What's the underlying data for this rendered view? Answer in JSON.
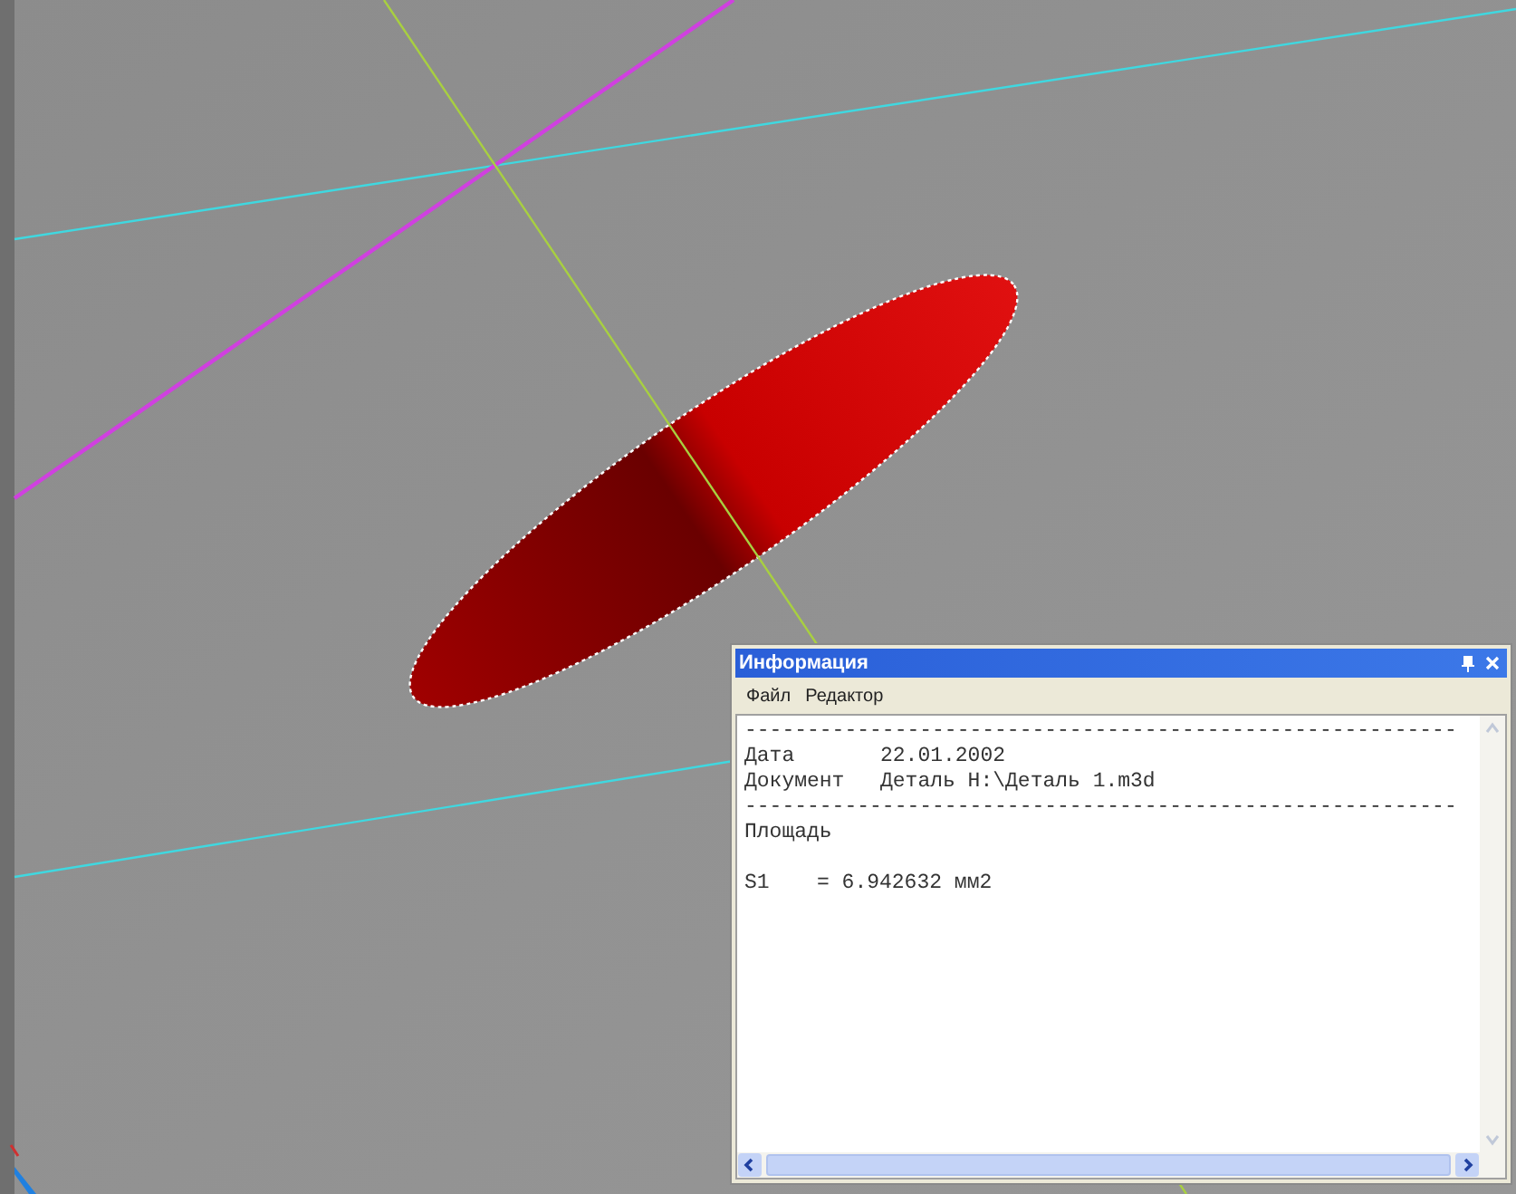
{
  "panel": {
    "title": "Информация",
    "menu": [
      {
        "label": "Файл"
      },
      {
        "label": "Редактор"
      }
    ],
    "lines": [
      {
        "kind": "rule",
        "text": "---------------------------------------------------------"
      },
      {
        "kind": "field",
        "label": "Дата",
        "value": "22.01.2002"
      },
      {
        "kind": "field",
        "label": "Документ",
        "value": "Деталь H:\\Деталь 1.m3d"
      },
      {
        "kind": "rule",
        "text": "---------------------------------------------------------"
      },
      {
        "kind": "text",
        "text": "Площадь"
      },
      {
        "kind": "blank"
      },
      {
        "kind": "result",
        "label": "S1",
        "value": "= 6.942632 мм2"
      }
    ]
  }
}
